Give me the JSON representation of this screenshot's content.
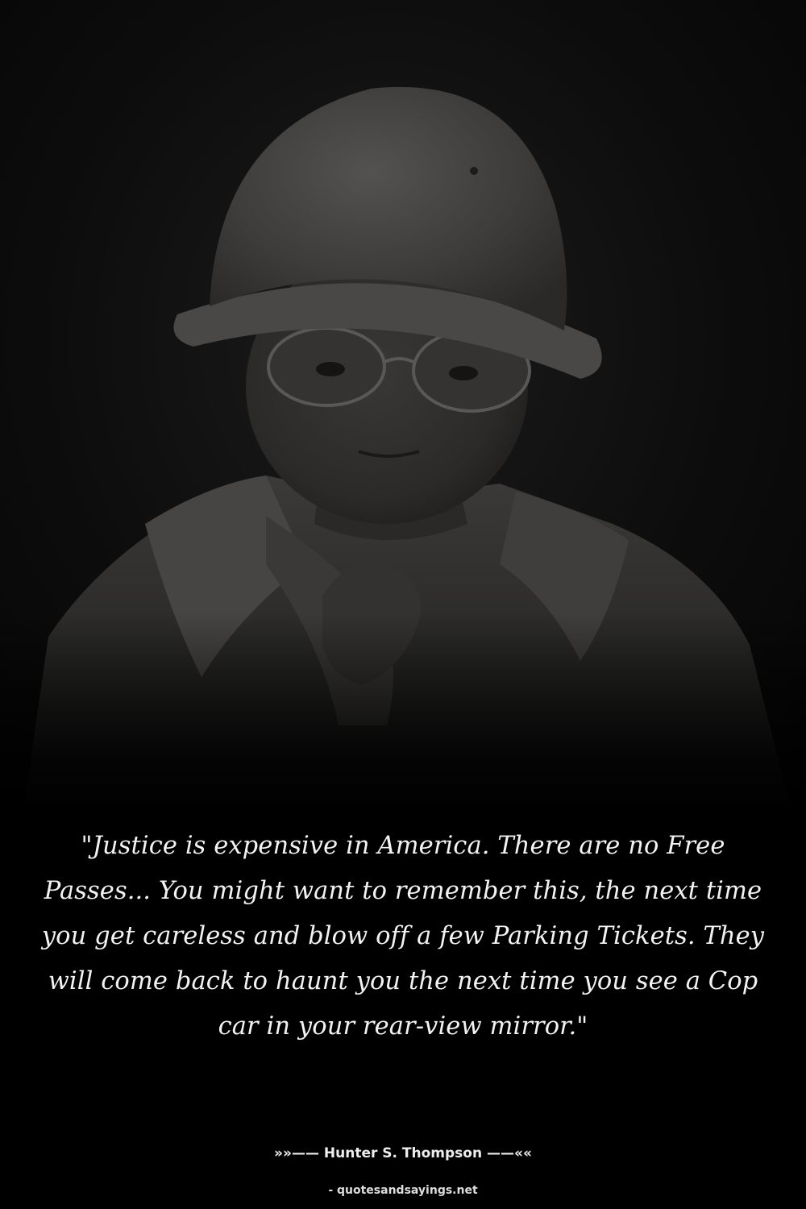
{
  "photo": {
    "subject": "black-and-white portrait of a man in a pith helmet and tinted glasses",
    "tone": "dark grayscale"
  },
  "quote": {
    "text": "\"Justice is expensive in America. There are no Free Passes... You might want to remember this, the next time you get careless and blow off a few Parking Tickets. They will come back to haunt you the next time you see a Cop car in your rear-view mirror.\""
  },
  "attribution": {
    "author_line": "»»—— Hunter S. Thompson ——««"
  },
  "footer": {
    "credit": "- quotesandsayings.net"
  },
  "colors": {
    "background": "#000000",
    "text": "#f2f2f2"
  }
}
